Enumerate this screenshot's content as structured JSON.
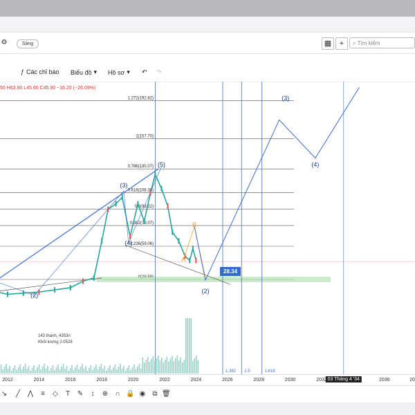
{
  "toolbar": {
    "toggle_label": "Sáng",
    "search_placeholder": "Tìm kiếm",
    "indicators_label": "Các chỉ báo",
    "chart_type_label": "Biểu đồ",
    "profile_label": "Hồ sơ"
  },
  "ohlc_text": "50  H63.90  L45.60  C45.90  −16.20 (−26.09%)",
  "tooltip": {
    "line1": "143 thanh, 4353n",
    "line2": "Khối lượng 2.0528"
  },
  "price_label": "28.34",
  "x_axis": {
    "ticks": [
      "2012",
      "2014",
      "2016",
      "2018",
      "2020",
      "2022",
      "2024",
      "2026",
      "2028",
      "2030",
      "2032",
      "2034",
      "2036",
      "20"
    ],
    "highlight": "03 Tháng 4 '34"
  },
  "chart_data": {
    "type": "line",
    "title": "",
    "xlabel": "",
    "ylabel": "",
    "x_range": [
      2011,
      2037
    ],
    "fibonacci_levels": [
      {
        "label": "1.272(192.82)",
        "value": 192.82
      },
      {
        "label": "1(157.70)",
        "value": 157.7
      },
      {
        "label": "0.786(130.07)",
        "value": 130.07
      },
      {
        "label": "0.618(108.38)",
        "value": 108.38
      },
      {
        "label": "0.5(93.22)",
        "value": 93.22
      },
      {
        "label": "0.382(78.07)",
        "value": 78.07
      },
      {
        "label": "0.236(59.06)",
        "value": 59.06
      },
      {
        "label": "0(28.59)",
        "value": 28.59
      }
    ],
    "fib_time_zones": [
      "1.382",
      "1.5",
      "1.618"
    ],
    "wave_labels": [
      {
        "label": "(1)",
        "x": 2011.0,
        "y": 28
      },
      {
        "label": "(2)",
        "x": 2013.7,
        "y": 12
      },
      {
        "label": "(3)",
        "x": 2019.4,
        "y": 113
      },
      {
        "label": "(4)",
        "x": 2019.7,
        "y": 60
      },
      {
        "label": "(5)",
        "x": 2021.8,
        "y": 132
      },
      {
        "label": "A",
        "x": 2023.2,
        "y": 45
      },
      {
        "label": "B",
        "x": 2023.9,
        "y": 77
      },
      {
        "label": "(2)",
        "x": 2024.6,
        "y": 16
      },
      {
        "label": "(3)",
        "x": 2029.7,
        "y": 193
      },
      {
        "label": "(4)",
        "x": 2031.6,
        "y": 132
      }
    ],
    "price_series": [
      {
        "x": 2011.0,
        "y": 18
      },
      {
        "x": 2012.0,
        "y": 15
      },
      {
        "x": 2013.0,
        "y": 16
      },
      {
        "x": 2014.0,
        "y": 17
      },
      {
        "x": 2015.0,
        "y": 19
      },
      {
        "x": 2016.0,
        "y": 21
      },
      {
        "x": 2016.8,
        "y": 27
      },
      {
        "x": 2017.5,
        "y": 30
      },
      {
        "x": 2018.0,
        "y": 64
      },
      {
        "x": 2018.4,
        "y": 93
      },
      {
        "x": 2018.9,
        "y": 98
      },
      {
        "x": 2019.3,
        "y": 104
      },
      {
        "x": 2019.8,
        "y": 68
      },
      {
        "x": 2020.3,
        "y": 98
      },
      {
        "x": 2020.7,
        "y": 82
      },
      {
        "x": 2021.1,
        "y": 108
      },
      {
        "x": 2021.4,
        "y": 125
      },
      {
        "x": 2021.8,
        "y": 112
      },
      {
        "x": 2022.2,
        "y": 96
      },
      {
        "x": 2022.5,
        "y": 72
      },
      {
        "x": 2022.9,
        "y": 64
      },
      {
        "x": 2023.3,
        "y": 50
      },
      {
        "x": 2023.6,
        "y": 46
      },
      {
        "x": 2023.8,
        "y": 57
      },
      {
        "x": 2024.0,
        "y": 46
      }
    ],
    "projection_path": [
      {
        "x": 2023.9,
        "y": 77
      },
      {
        "x": 2024.6,
        "y": 28
      },
      {
        "x": 2029.3,
        "y": 175
      },
      {
        "x": 2031.6,
        "y": 140
      },
      {
        "x": 2034.4,
        "y": 205
      }
    ]
  }
}
